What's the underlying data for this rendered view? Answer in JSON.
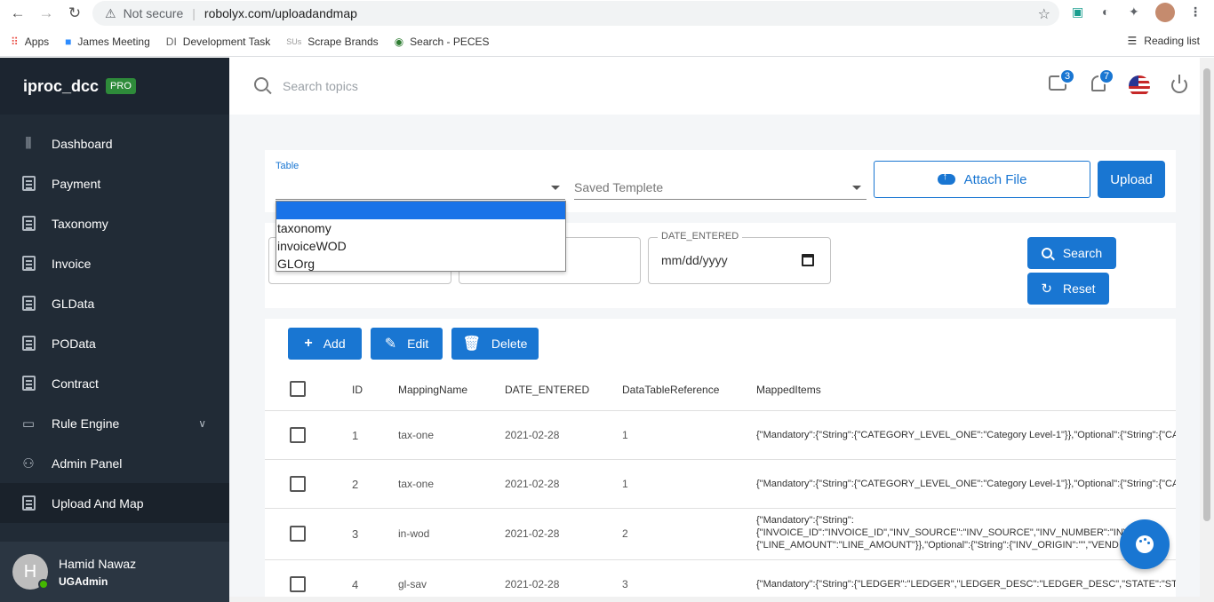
{
  "browser": {
    "security_label": "Not secure",
    "url": "robolyx.com/uploadandmap",
    "bookmarks": [
      {
        "label": "Apps",
        "icon": "apps-grid-icon"
      },
      {
        "label": "James Meeting",
        "icon": "zoom-icon"
      },
      {
        "label": "Development Task",
        "icon": "di-icon"
      },
      {
        "label": "Scrape Brands",
        "icon": "sus-icon"
      },
      {
        "label": "Search - PECES",
        "icon": "globe-icon"
      }
    ],
    "reading_list": "Reading list"
  },
  "sidebar": {
    "brand": "iproc_dcc",
    "badge": "PRO",
    "items": [
      {
        "label": "Dashboard",
        "icon": "sliders-icon"
      },
      {
        "label": "Payment",
        "icon": "document-icon"
      },
      {
        "label": "Taxonomy",
        "icon": "document-icon"
      },
      {
        "label": "Invoice",
        "icon": "document-icon"
      },
      {
        "label": "GLData",
        "icon": "document-icon"
      },
      {
        "label": "POData",
        "icon": "document-icon"
      },
      {
        "label": "Contract",
        "icon": "document-icon"
      },
      {
        "label": "Rule Engine",
        "icon": "briefcase-icon"
      },
      {
        "label": "Admin Panel",
        "icon": "people-icon"
      },
      {
        "label": "Upload And Map",
        "icon": "document-icon"
      }
    ],
    "user": {
      "initial": "H",
      "name": "Hamid Nawaz",
      "role": "UGAdmin"
    }
  },
  "header": {
    "search_placeholder": "Search topics",
    "chat_count": "3",
    "notification_count": "7"
  },
  "upload": {
    "table_label": "Table",
    "template_placeholder": "Saved Templete",
    "attach_label": "Attach File",
    "upload_label": "Upload",
    "dropdown_options": [
      "",
      "taxonomy",
      "invoiceWOD",
      "GLOrg"
    ]
  },
  "filter": {
    "date_label": "DATE_ENTERED",
    "date_value": "mm/dd/yyyy",
    "search_label": "Search",
    "reset_label": "Reset"
  },
  "table": {
    "add_label": "Add",
    "edit_label": "Edit",
    "delete_label": "Delete",
    "columns": [
      "ID",
      "MappingName",
      "DATE_ENTERED",
      "DataTableReference",
      "MappedItems"
    ],
    "rows": [
      {
        "id": "1",
        "name": "tax-one",
        "date": "2021-02-28",
        "ref": "1",
        "mapped": [
          "{\"Mandatory\":{\"String\":{\"CATEGORY_LEVEL_ONE\":\"Category Level-1\"}},\"Optional\":{\"String\":{\"CA"
        ]
      },
      {
        "id": "2",
        "name": "tax-one",
        "date": "2021-02-28",
        "ref": "1",
        "mapped": [
          "{\"Mandatory\":{\"String\":{\"CATEGORY_LEVEL_ONE\":\"Category Level-1\"}},\"Optional\":{\"String\":{\"CA"
        ]
      },
      {
        "id": "3",
        "name": "in-wod",
        "date": "2021-02-28",
        "ref": "2",
        "mapped": [
          "{\"Mandatory\":{\"String\":",
          "{\"INVOICE_ID\":\"INVOICE_ID\",\"INV_SOURCE\":\"INV_SOURCE\",\"INV_NUMBER\":\"INV",
          "{\"LINE_AMOUNT\":\"LINE_AMOUNT\"}},\"Optional\":{\"String\":{\"INV_ORIGIN\":\"\",\"VEND"
        ]
      },
      {
        "id": "4",
        "name": "gl-sav",
        "date": "2021-02-28",
        "ref": "3",
        "mapped": [
          "{\"Mandatory\":{\"String\":{\"LEDGER\":\"LEDGER\",\"LEDGER_DESC\":\"LEDGER_DESC\",\"STATE\":\"STAT"
        ]
      }
    ]
  }
}
